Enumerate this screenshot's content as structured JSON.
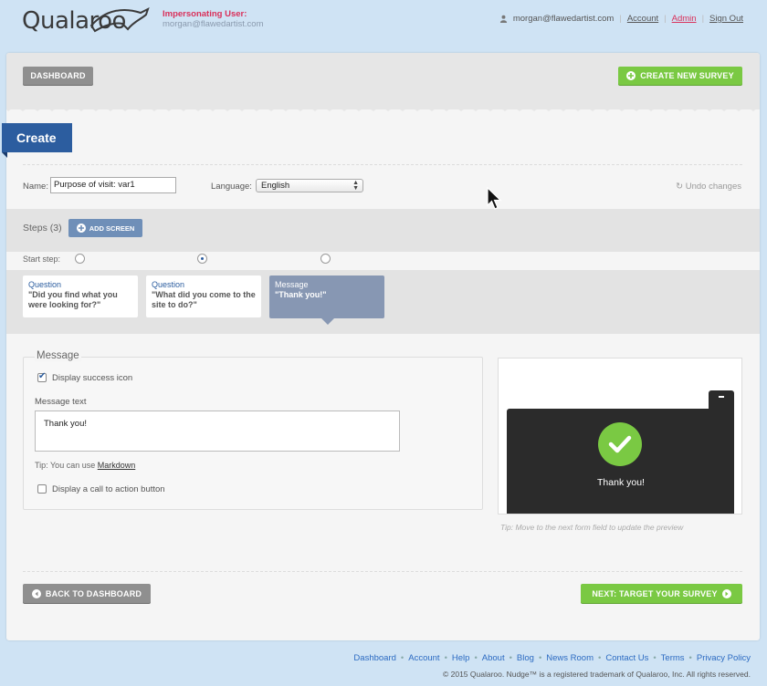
{
  "header": {
    "logo": "Qualaroo",
    "impersonating_label": "Impersonating User:",
    "impersonating_email": "morgan@flawedartist.com",
    "user_email": "morgan@flawedartist.com",
    "links": {
      "account": "Account",
      "admin": "Admin",
      "sign_out": "Sign Out"
    }
  },
  "toolbar": {
    "dashboard_label": "DASHBOARD",
    "create_survey_label": "CREATE NEW SURVEY"
  },
  "section_title": "Create",
  "form": {
    "name_label": "Name:",
    "name_value": "Purpose of visit: var1",
    "language_label": "Language:",
    "language_value": "English",
    "undo_label": "Undo changes"
  },
  "steps": {
    "label": "Steps (3)",
    "add_screen_label": "ADD SCREEN",
    "start_step_label": "Start step:",
    "selected_start_index": 1,
    "cards": [
      {
        "type": "Question",
        "text": "\"Did you find what you were looking for?\""
      },
      {
        "type": "Question",
        "text": "\"What did you come to the site to do?\""
      },
      {
        "type": "Message",
        "text": "\"Thank you!\""
      }
    ]
  },
  "message": {
    "legend": "Message",
    "display_success_icon_label": "Display success icon",
    "display_success_icon_checked": true,
    "message_text_label": "Message text",
    "message_text_value": "Thank you!",
    "tip_prefix": "Tip: You can use",
    "tip_link": "Markdown",
    "cta_label": "Display a call to action button",
    "cta_checked": false
  },
  "preview": {
    "thanks_text": "Thank you!",
    "minimize_icon": "minus-icon",
    "tip": "Tip: Move to the next form field to update the preview"
  },
  "nav": {
    "back_label": "BACK TO DASHBOARD",
    "next_label": "NEXT: TARGET YOUR SURVEY"
  },
  "footer": {
    "links": [
      "Dashboard",
      "Account",
      "Help",
      "About",
      "Blog",
      "News Room",
      "Contact Us",
      "Terms",
      "Privacy Policy"
    ],
    "copyright": "© 2015 Qualaroo. Nudge™ is a registered trademark of Qualaroo, Inc. All rights reserved."
  },
  "colors": {
    "page_bg": "#cfe3f4",
    "accent_blue": "#2c5d9f",
    "green": "#7ac943",
    "gray_button": "#8f8f8f",
    "admin_red": "#d9305a"
  }
}
